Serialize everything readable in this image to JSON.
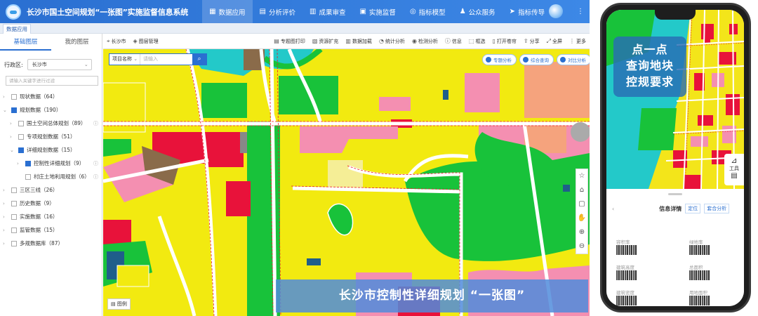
{
  "app": {
    "title": "长沙市国土空间规划“一张图”实施监督信息系统",
    "nav": [
      {
        "icon": "▦",
        "label": "数据应用"
      },
      {
        "icon": "▤",
        "label": "分析评价"
      },
      {
        "icon": "▥",
        "label": "成果审查"
      },
      {
        "icon": "▣",
        "label": "实施监督"
      },
      {
        "icon": "◎",
        "label": "指标模型"
      },
      {
        "icon": "♟",
        "label": "公众服务"
      },
      {
        "icon": "➤",
        "label": "指标传导"
      }
    ],
    "more": "⋮",
    "tab": "数据应用"
  },
  "sidebar": {
    "tabs": [
      "基础图层",
      "我的图层"
    ],
    "region_label": "行政区:",
    "region_value": "长沙市",
    "search_placeholder": "请输入关键字进行过滤",
    "tree": [
      {
        "level": 0,
        "arrow": "›",
        "checked": false,
        "label": "现状数据（64）",
        "info": false
      },
      {
        "level": 0,
        "arrow": "⌄",
        "checked": true,
        "label": "规划数据（190）",
        "info": false
      },
      {
        "level": 1,
        "arrow": "›",
        "checked": false,
        "label": "国土空间总体规划（89）",
        "info": true
      },
      {
        "level": 1,
        "arrow": "›",
        "checked": false,
        "label": "专项规划数据（51）",
        "info": false
      },
      {
        "level": 1,
        "arrow": "⌄",
        "checked": true,
        "label": "详细规划数据（15）",
        "info": false
      },
      {
        "level": 2,
        "arrow": "›",
        "checked": true,
        "label": "控制性详细规划（9）",
        "info": true
      },
      {
        "level": 2,
        "arrow": "",
        "checked": false,
        "label": "村庄土地利用规划（6）",
        "info": true
      },
      {
        "level": 0,
        "arrow": "›",
        "checked": false,
        "label": "三区三线（26）",
        "info": false
      },
      {
        "level": 0,
        "arrow": "›",
        "checked": false,
        "label": "历史数据（9）",
        "info": false
      },
      {
        "level": 0,
        "arrow": "›",
        "checked": false,
        "label": "实施数据（16）",
        "info": false
      },
      {
        "level": 0,
        "arrow": "›",
        "checked": false,
        "label": "监管数据（15）",
        "info": false
      },
      {
        "level": 0,
        "arrow": "›",
        "checked": false,
        "label": "多规数据库（87）",
        "info": false
      }
    ]
  },
  "map": {
    "toolbar_left": [
      {
        "icon": "⌖",
        "label": "长沙市"
      },
      {
        "icon": "◈",
        "label": "图层管理"
      }
    ],
    "toolbar_right": [
      {
        "icon": "▤",
        "label": "专题图打印"
      },
      {
        "icon": "▧",
        "label": "资源扩充"
      },
      {
        "icon": "▥",
        "label": "数据加载"
      },
      {
        "icon": "◔",
        "label": "统计分析"
      },
      {
        "icon": "◉",
        "label": "检测分析"
      },
      {
        "icon": "ⓘ",
        "label": "信息"
      },
      {
        "icon": "⬚",
        "label": "框选"
      },
      {
        "icon": "▯",
        "label": "打开卷帘"
      },
      {
        "icon": "⇪",
        "label": "分享"
      },
      {
        "icon": "⤢",
        "label": "全屏"
      },
      {
        "icon": "⋮",
        "label": "更多"
      }
    ],
    "search_field": "项目名称",
    "search_placeholder": "请输入",
    "pills": [
      "专题分析",
      "综合查询",
      "对比分析"
    ],
    "right_tools": [
      "☆",
      "⌂",
      "▢",
      "✋",
      "⊕",
      "⊖"
    ],
    "legend": "图例",
    "banner": "长沙市控制性详细规划 “一张图”"
  },
  "phone": {
    "callout": [
      "点一点",
      "查询地块",
      "控规要求"
    ],
    "tool_label": "工具",
    "sheet_title": "信息详情",
    "sheet_buttons": [
      "定位",
      "套合分析"
    ],
    "attrs": [
      "容积率",
      "绿地率",
      "建筑高度",
      "总面积",
      "建筑密度",
      "用地面积"
    ]
  },
  "colors": {
    "residential": "#f2ea10",
    "commercial": "#e8123a",
    "green": "#18c23a",
    "water": "#23c9c9",
    "industrial": "#8a6b4a",
    "public": "#f48fb1",
    "accent": "#2a6fd1"
  }
}
